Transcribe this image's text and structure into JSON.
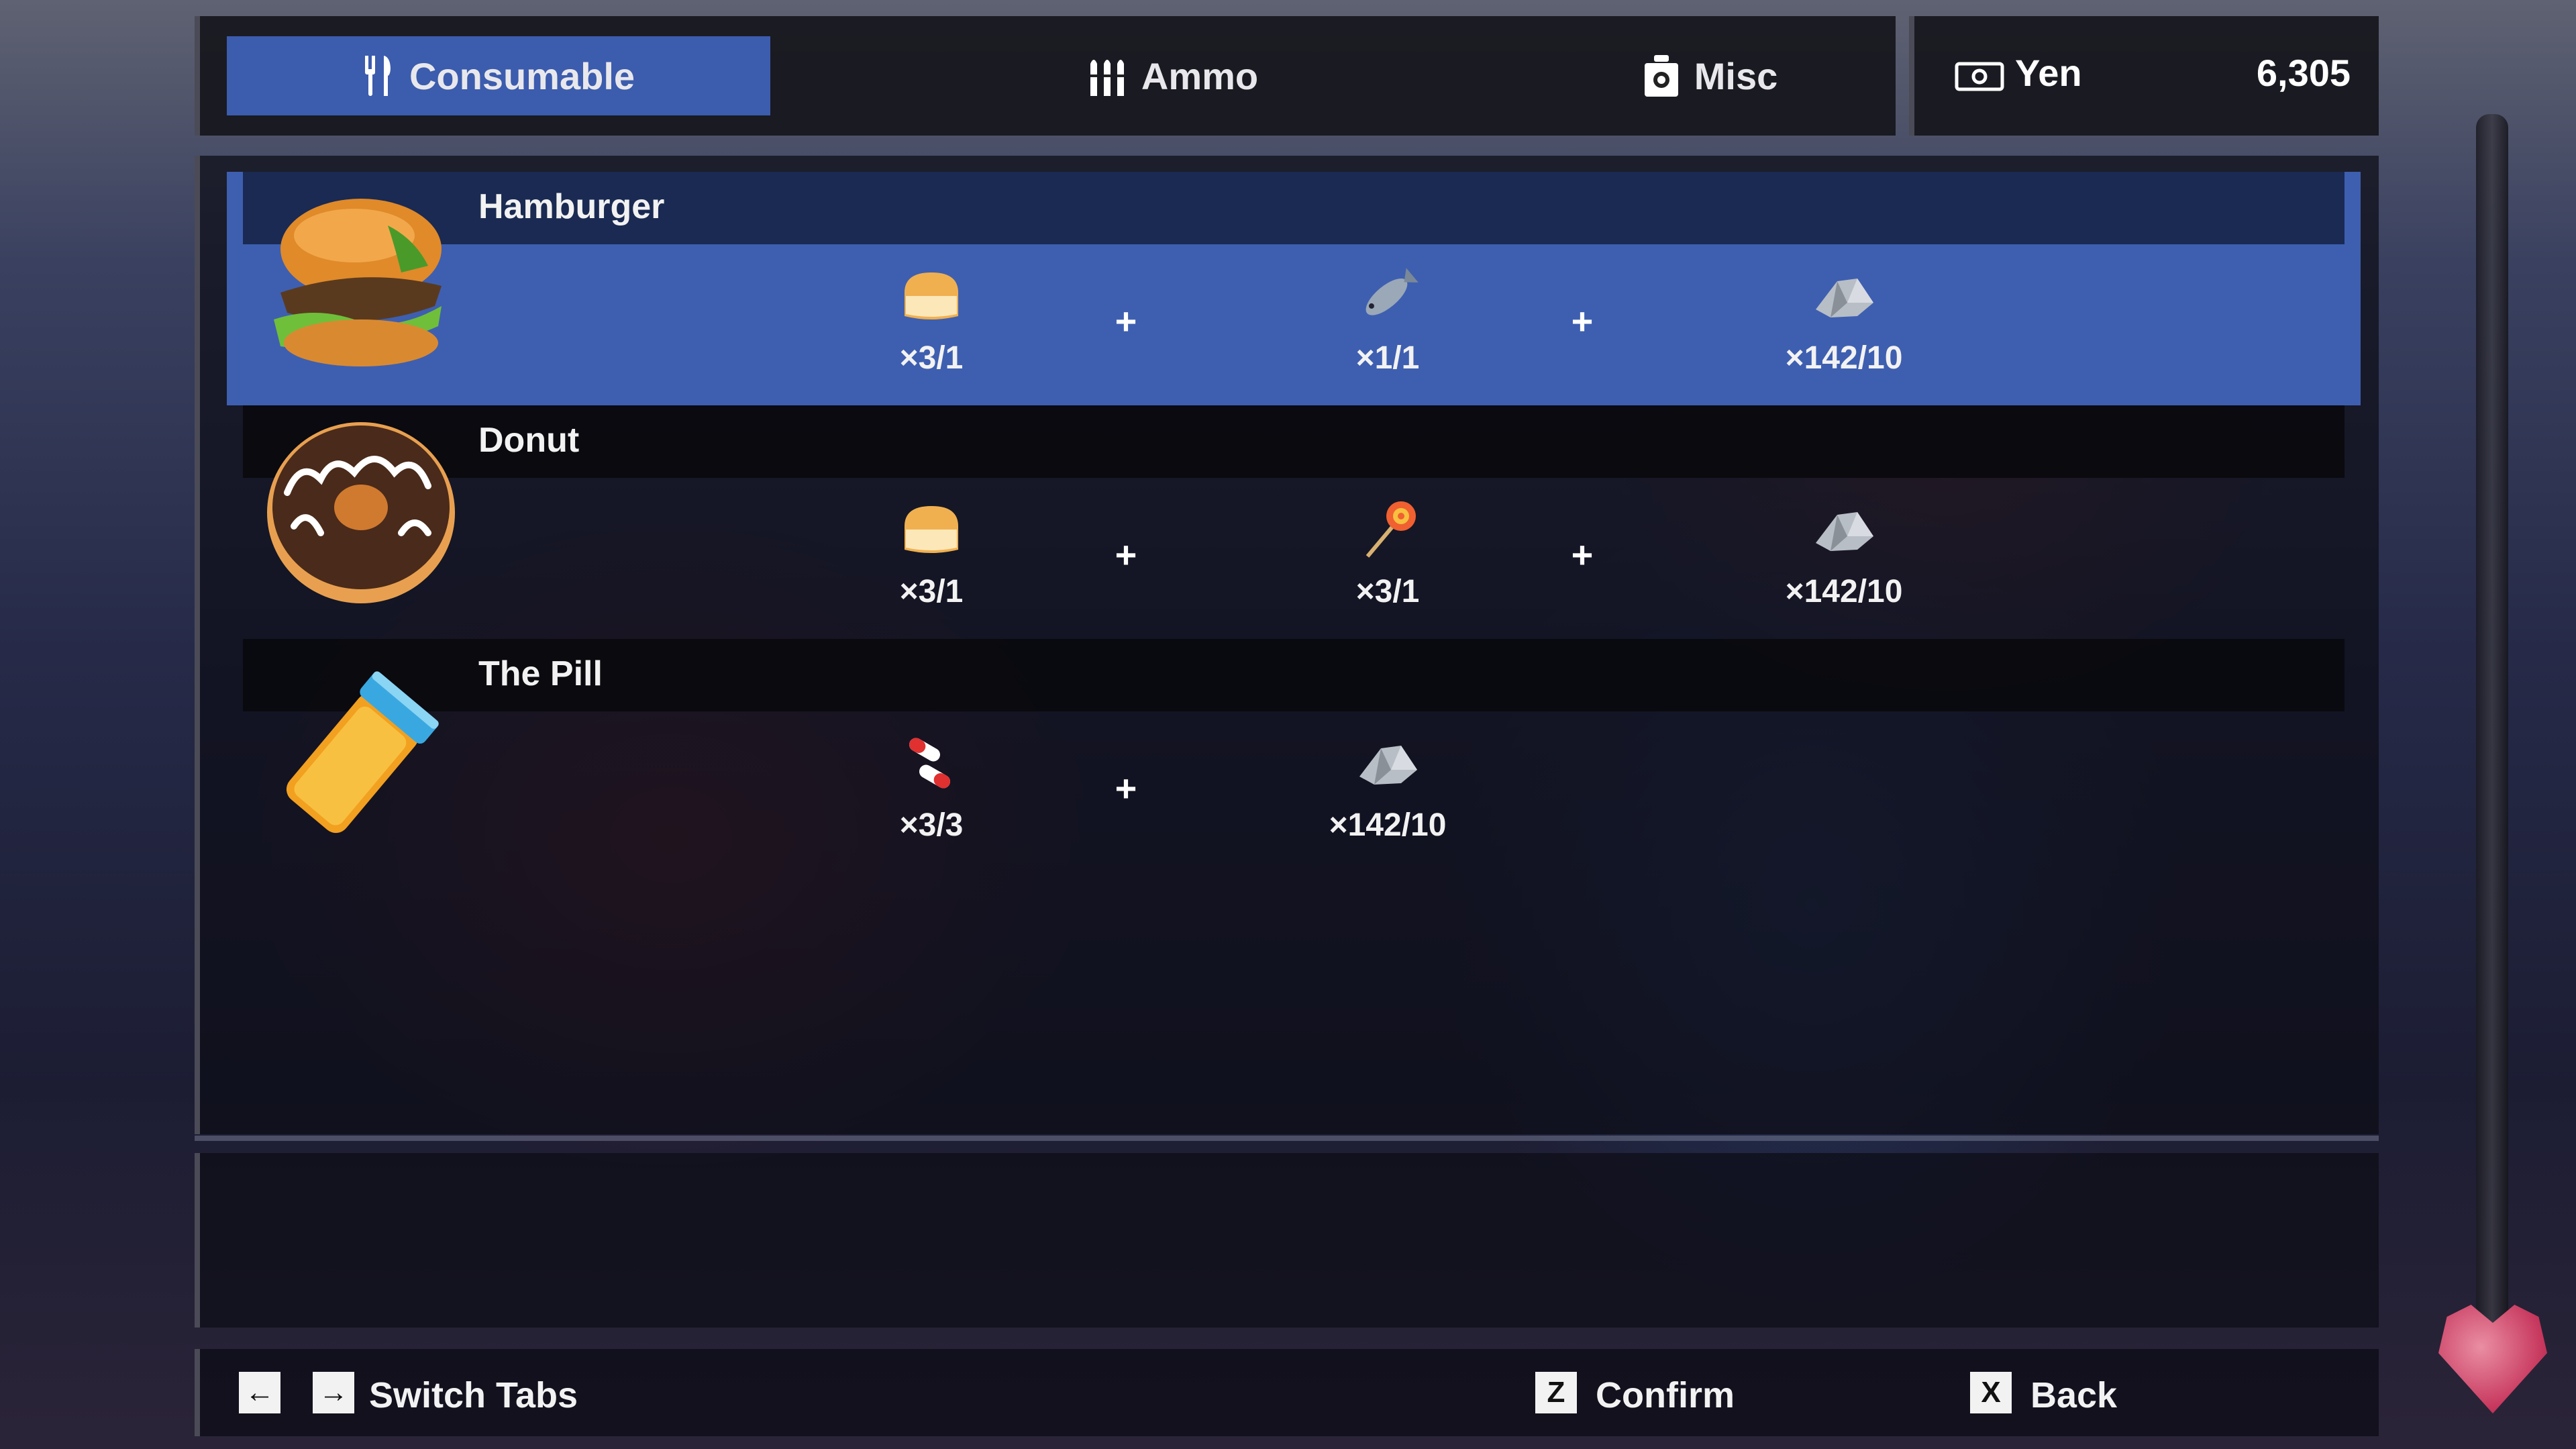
{
  "tabs": [
    {
      "label": "Consumable",
      "icon": "fork-knife-icon",
      "active": true
    },
    {
      "label": "Ammo",
      "icon": "ammo-icon",
      "active": false
    },
    {
      "label": "Misc",
      "icon": "misc-box-icon",
      "active": false
    }
  ],
  "currency": {
    "label": "Yen",
    "value": "6,305",
    "icon": "money-icon"
  },
  "recipes": [
    {
      "name": "Hamburger",
      "icon": "hamburger-icon",
      "selected": true,
      "ingredients": [
        {
          "icon": "bread-icon",
          "qty": "×3/1"
        },
        {
          "icon": "fish-icon",
          "qty": "×1/1"
        },
        {
          "icon": "scrap-metal-icon",
          "qty": "×142/10"
        }
      ]
    },
    {
      "name": "Donut",
      "icon": "donut-icon",
      "selected": false,
      "ingredients": [
        {
          "icon": "bread-icon",
          "qty": "×3/1"
        },
        {
          "icon": "lollipop-icon",
          "qty": "×3/1"
        },
        {
          "icon": "scrap-metal-icon",
          "qty": "×142/10"
        }
      ]
    },
    {
      "name": "The Pill",
      "icon": "pill-bottle-icon",
      "selected": false,
      "ingredients": [
        {
          "icon": "capsules-icon",
          "qty": "×3/3"
        },
        {
          "icon": "scrap-metal-icon",
          "qty": "×142/10"
        }
      ]
    }
  ],
  "plus_sign": "+",
  "controls": [
    {
      "keys": [
        "←",
        "→"
      ],
      "label": "Switch Tabs"
    },
    {
      "keys": [
        "Z"
      ],
      "label": "Confirm"
    },
    {
      "keys": [
        "X"
      ],
      "label": "Back"
    }
  ]
}
